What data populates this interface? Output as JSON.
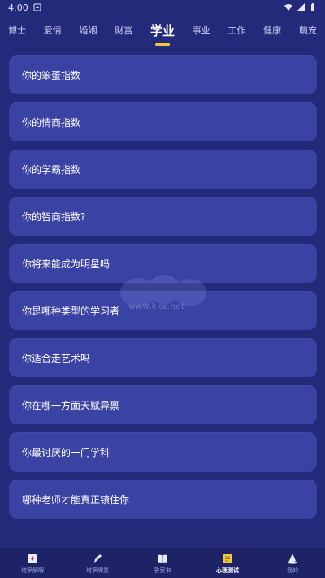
{
  "status": {
    "time": "4:00"
  },
  "tabs": [
    {
      "label": "博士",
      "active": false
    },
    {
      "label": "爱情",
      "active": false
    },
    {
      "label": "婚姻",
      "active": false
    },
    {
      "label": "财富",
      "active": false
    },
    {
      "label": "学业",
      "active": true
    },
    {
      "label": "事业",
      "active": false
    },
    {
      "label": "工作",
      "active": false
    },
    {
      "label": "健康",
      "active": false
    },
    {
      "label": "萌宠",
      "active": false
    }
  ],
  "quizzes": [
    "你的笨蛋指数",
    "你的情商指数",
    "你的学霸指数",
    "你的智商指数?",
    "你将来能成为明星吗",
    "你是哪种类型的学习者",
    "你适合走艺术吗",
    "你在哪一方面天赋异禀",
    "你最讨厌的一门学科",
    "哪种老师才能真正镇住你"
  ],
  "watermark": {
    "text": "www.kkx.net"
  },
  "bottom_nav": [
    {
      "label": "塔罗解牌",
      "icon": "tarot-card-icon",
      "active": false
    },
    {
      "label": "塔罗牌意",
      "icon": "pen-icon",
      "active": false
    },
    {
      "label": "答案书",
      "icon": "book-icon",
      "active": false
    },
    {
      "label": "心理测试",
      "icon": "notepad-icon",
      "active": true
    },
    {
      "label": "我的",
      "icon": "wizard-hat-icon",
      "active": false
    }
  ],
  "colors": {
    "background": "#232a7a",
    "card": "#3a43a3",
    "accent": "#f5c842",
    "nav_bg": "#1d2366"
  }
}
